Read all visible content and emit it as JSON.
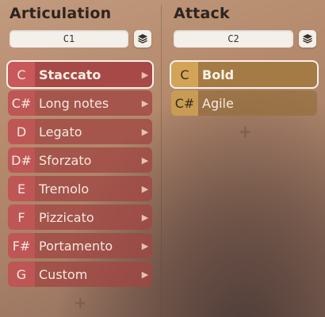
{
  "articulation": {
    "title": "Articulation",
    "slot": "C1",
    "items": [
      {
        "key": "C",
        "label": "Staccato",
        "selected": true
      },
      {
        "key": "C#",
        "label": "Long notes"
      },
      {
        "key": "D",
        "label": "Legato"
      },
      {
        "key": "D#",
        "label": "Sforzato"
      },
      {
        "key": "E",
        "label": "Tremolo"
      },
      {
        "key": "F",
        "label": "Pizzicato"
      },
      {
        "key": "F#",
        "label": "Portamento"
      },
      {
        "key": "G",
        "label": "Custom"
      }
    ],
    "add_label": "+"
  },
  "attack": {
    "title": "Attack",
    "slot": "C2",
    "items": [
      {
        "key": "C",
        "label": "Bold",
        "selected": true
      },
      {
        "key": "C#",
        "label": "Agile"
      }
    ],
    "add_label": "+"
  },
  "colors": {
    "articulation_accent": "#c9585a",
    "attack_accent": "#d3a458",
    "selection_outline": "#f7f1ea"
  },
  "icons": {
    "layers": "layers-icon",
    "chevron": "chevron-right-icon",
    "add": "plus-icon"
  }
}
